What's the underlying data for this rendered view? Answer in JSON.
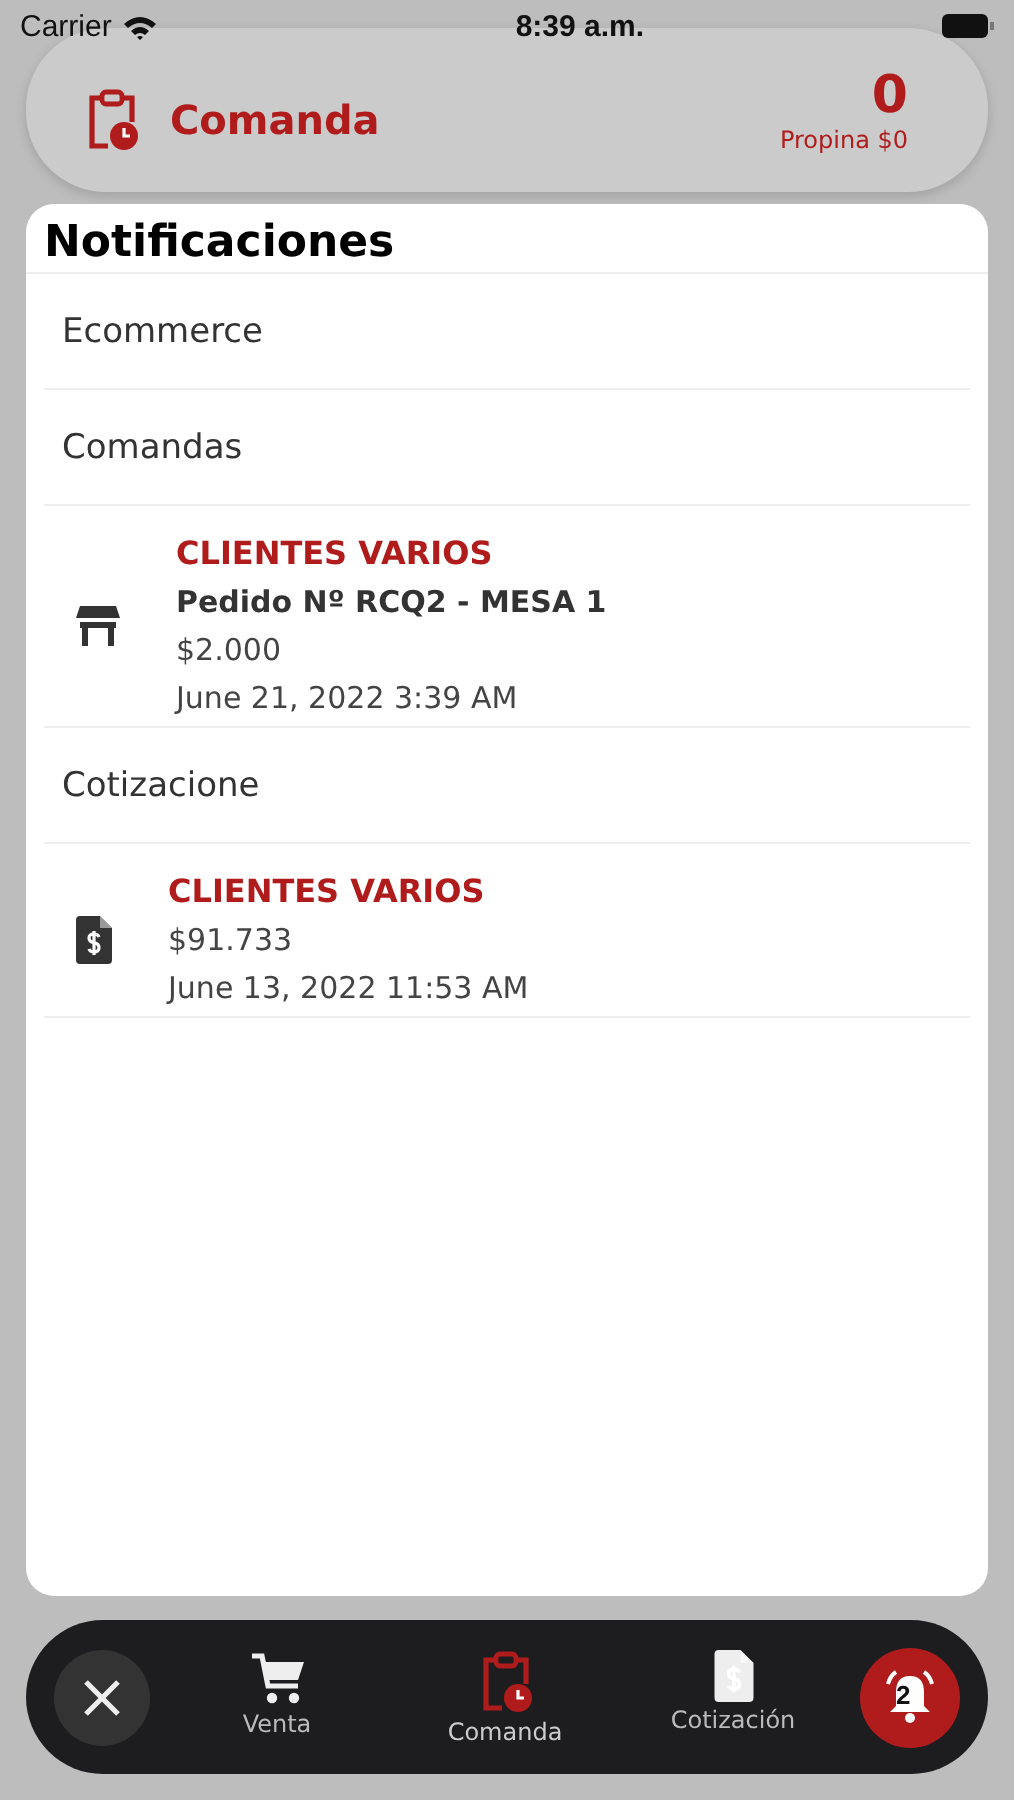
{
  "status_bar": {
    "carrier": "Carrier",
    "time": "8:39 a.m."
  },
  "header": {
    "title": "Comanda",
    "count": "0",
    "tip": "Propina $0"
  },
  "notifications": {
    "title": "Notificaciones",
    "rows": [
      {
        "kind": "section",
        "label": "Ecommerce"
      },
      {
        "kind": "section",
        "label": "Comandas"
      },
      {
        "kind": "order",
        "client": "CLIENTES VARIOS",
        "order": "Pedido Nº RCQ2 - MESA 1",
        "amount": "$2.000",
        "date": "June 21, 2022 3:39 AM"
      },
      {
        "kind": "section",
        "label": "Cotizacione"
      },
      {
        "kind": "quote",
        "client": "CLIENTES VARIOS",
        "amount": "$91.733",
        "date": "June 13, 2022 11:53 AM"
      }
    ]
  },
  "nav": {
    "items": [
      {
        "label": "Venta",
        "selected": false
      },
      {
        "label": "Comanda",
        "selected": true
      },
      {
        "label": "Cotización",
        "selected": false
      }
    ],
    "badge": "2"
  }
}
